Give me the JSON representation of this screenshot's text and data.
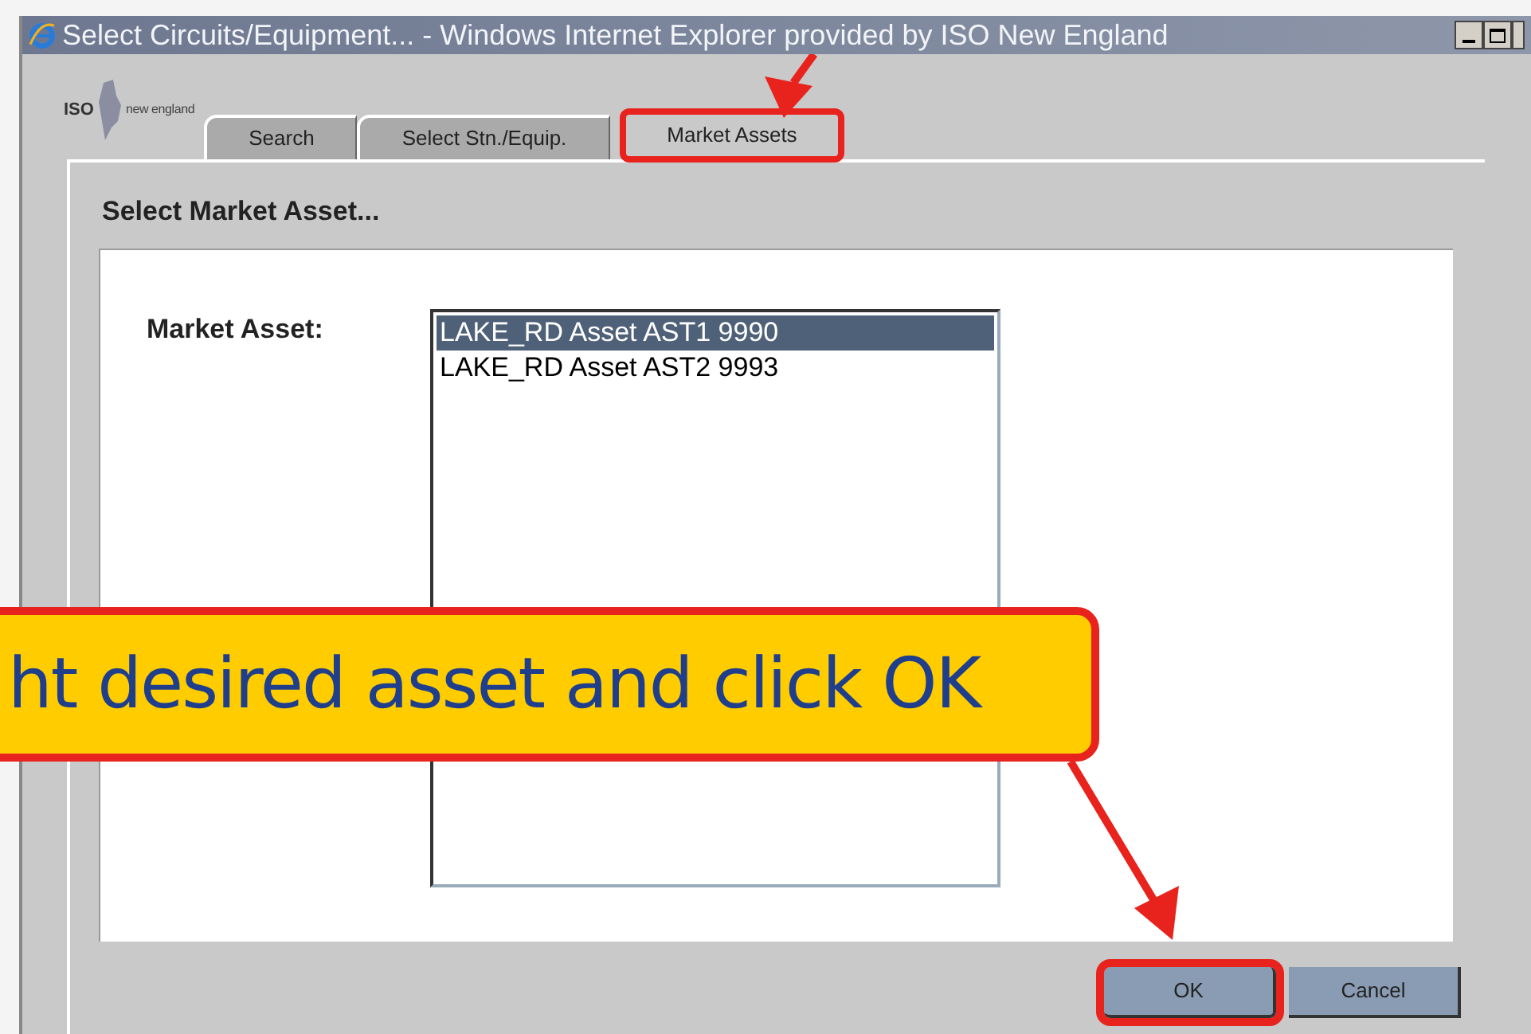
{
  "window": {
    "title": "Select Circuits/Equipment... - Windows Internet Explorer provided by ISO New England"
  },
  "logo": {
    "acronym": "ISO",
    "region": "new england"
  },
  "tabs": [
    {
      "label": "Search",
      "selected": false
    },
    {
      "label": "Select Stn./Equip.",
      "selected": false
    },
    {
      "label": "Market Assets",
      "selected": true
    }
  ],
  "panel": {
    "heading": "Select Market Asset...",
    "field_label": "Market Asset:"
  },
  "asset_list": [
    {
      "label": "LAKE_RD Asset AST1 9990",
      "selected": true
    },
    {
      "label": "LAKE_RD Asset AST2 9993",
      "selected": false
    }
  ],
  "buttons": [
    {
      "label": "OK",
      "highlighted": true
    },
    {
      "label": "Cancel",
      "highlighted": false
    }
  ],
  "callout": {
    "text": "ht desired asset and click OK"
  }
}
